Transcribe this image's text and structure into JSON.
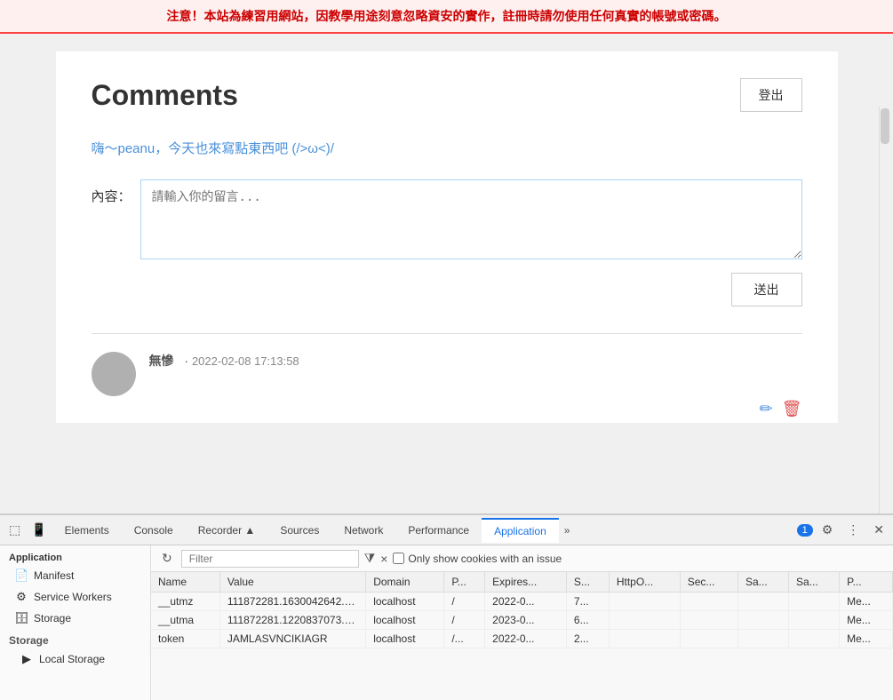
{
  "warning": {
    "text": "注意！本站為練習用網站，因教學用途刻意忽略資安的實作，註冊時請勿使用任何真實的帳號或密碼。"
  },
  "page": {
    "title": "Comments",
    "logout_label": "登出",
    "greeting": "嗨～peanu，今天也來寫點東西吧 (/>ω<)/",
    "form": {
      "label": "內容：",
      "placeholder": "請輸入你的留言...",
      "submit_label": "送出"
    }
  },
  "comment": {
    "author": "無慘",
    "dot": "·",
    "timestamp": "2022-02-08 17:13:58"
  },
  "devtools": {
    "tabs": [
      "Elements",
      "Console",
      "Recorder ▲",
      "Sources",
      "Network",
      "Performance",
      "Application"
    ],
    "active_tab": "Application",
    "more_label": "»",
    "badge": "1",
    "sidebar": {
      "top_section": "Application",
      "items": [
        {
          "id": "manifest",
          "label": "Manifest",
          "icon": "📄"
        },
        {
          "id": "service-workers",
          "label": "Service Workers",
          "icon": "⚙"
        },
        {
          "id": "storage",
          "label": "Storage",
          "icon": "🗄"
        }
      ],
      "storage_group": "Storage",
      "storage_items": [
        {
          "id": "local-storage",
          "label": "Local Storage",
          "icon": "▶"
        }
      ]
    },
    "cookies": {
      "toolbar": {
        "refresh_icon": "↻",
        "filter_placeholder": "Filter",
        "funnel_icon": "⧩",
        "clear_icon": "×",
        "checkbox_label": "Only show cookies with an issue"
      },
      "columns": [
        "Name",
        "Value",
        "Domain",
        "P...",
        "Expires...",
        "S...",
        "HttpO...",
        "Sec...",
        "Sa...",
        "Sa...",
        "P..."
      ],
      "rows": [
        {
          "name": "__utmz",
          "value": "111872281.1630042642.1.1....",
          "domain": "localhost",
          "path": "/",
          "expires": "2022-0...",
          "size": "7...",
          "httponly": "",
          "secure": "",
          "samesite": "",
          "samesite2": "",
          "priority": "Me..."
        },
        {
          "name": "__utma",
          "value": "111872281.1220837073.163...",
          "domain": "localhost",
          "path": "/",
          "expires": "2023-0...",
          "size": "6...",
          "httponly": "",
          "secure": "",
          "samesite": "",
          "samesite2": "",
          "priority": "Me..."
        },
        {
          "name": "token",
          "value": "JAMLASVNCIKIAGR",
          "domain": "localhost",
          "path": "/...",
          "expires": "2022-0...",
          "size": "2...",
          "httponly": "",
          "secure": "",
          "samesite": "",
          "samesite2": "",
          "priority": "Me..."
        }
      ]
    }
  }
}
